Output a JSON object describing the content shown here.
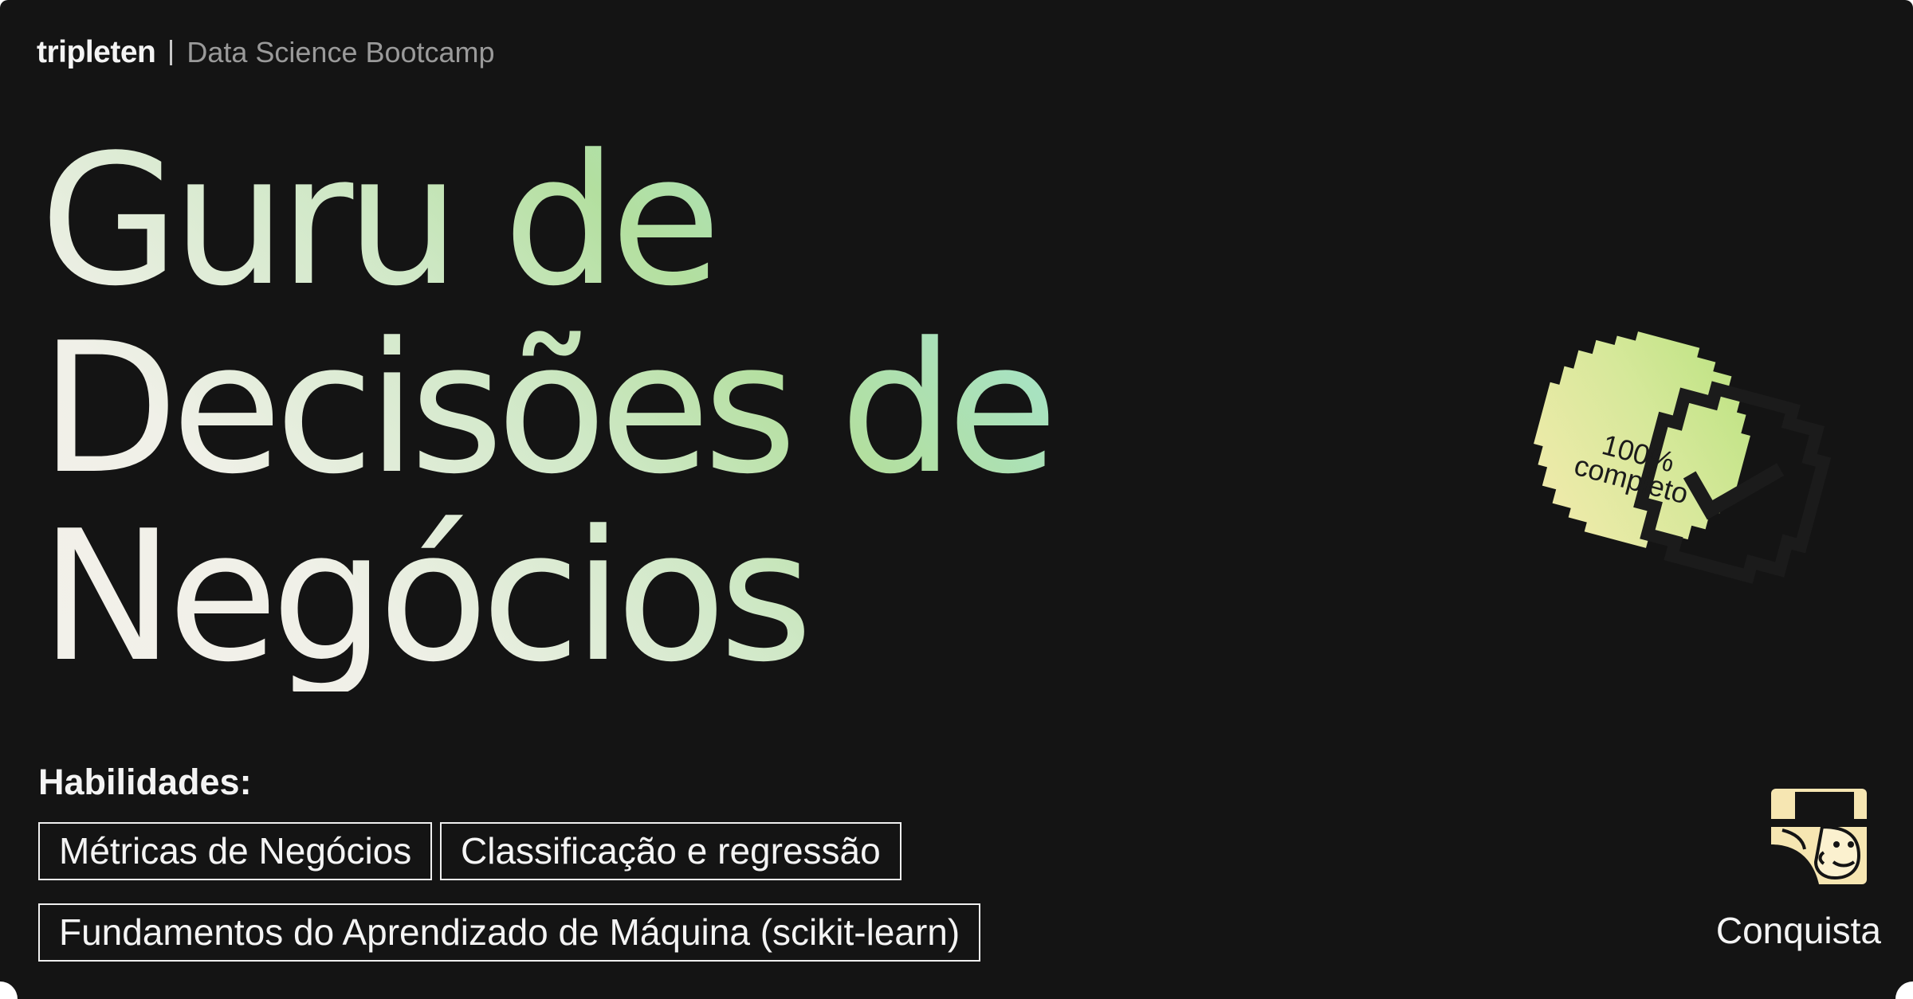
{
  "brand": {
    "logo": "tripleten",
    "program": "Data Science Bootcamp"
  },
  "title": {
    "line1": "Guru de",
    "line2": "Decisões de",
    "line3": "Negócios"
  },
  "badge": {
    "percent": "100%",
    "word": "completo",
    "icon": "check-circle-icon"
  },
  "skills": {
    "label": "Habilidades:",
    "items": [
      "Métricas de Negócios",
      "Classificação e regressão",
      "Fundamentos do Aprendizado de Máquina (scikit-learn)"
    ]
  },
  "achievement": {
    "label": "Conquista",
    "icon": "detective-character-icon"
  },
  "colors": {
    "background": "#141414",
    "title_gradient": [
      "#f3f1ea",
      "#b3df9f",
      "#9be0cc"
    ],
    "badge_gradient": [
      "#f3e7a6",
      "#c6e58c"
    ],
    "text": "#f4f4f4",
    "muted": "#9a9a9a"
  }
}
